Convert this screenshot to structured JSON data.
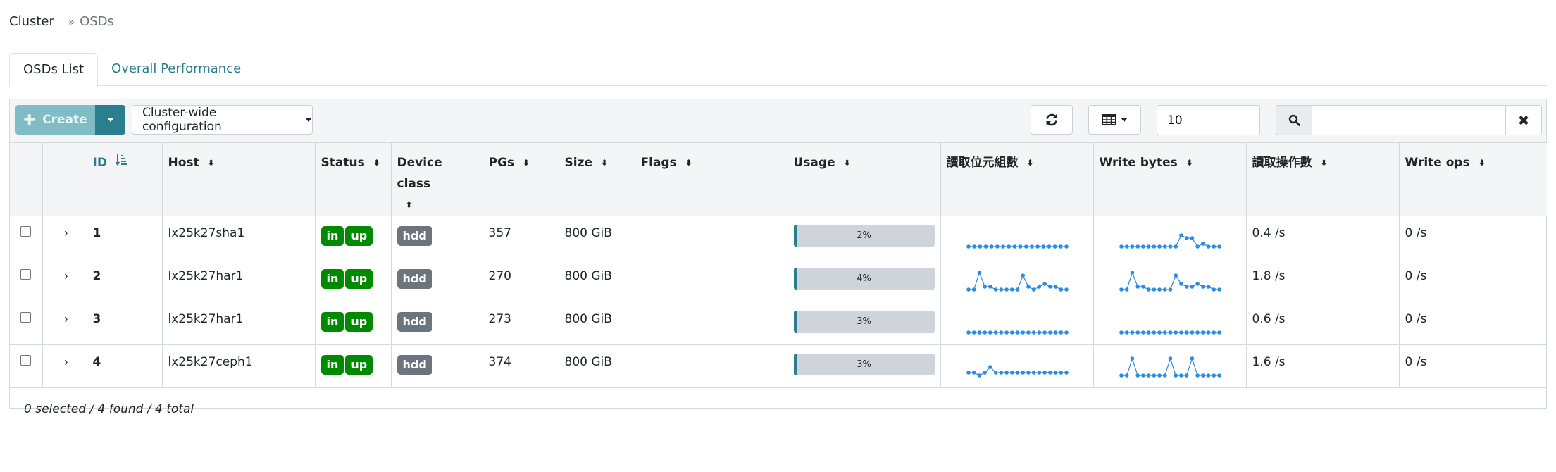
{
  "breadcrumb": {
    "root": "Cluster",
    "sep": "»",
    "current": "OSDs"
  },
  "tabs": [
    {
      "label": "OSDs List",
      "active": true
    },
    {
      "label": "Overall Performance",
      "active": false
    }
  ],
  "toolbar": {
    "create_label": "Create",
    "config_label": "Cluster-wide configuration",
    "page_size": "10",
    "search_value": "",
    "clear_label": "✖"
  },
  "columns": [
    {
      "label": ""
    },
    {
      "label": ""
    },
    {
      "label": "ID",
      "sort": "asc"
    },
    {
      "label": "Host"
    },
    {
      "label": "Status"
    },
    {
      "label": "Device class"
    },
    {
      "label": "PGs"
    },
    {
      "label": "Size"
    },
    {
      "label": "Flags"
    },
    {
      "label": "Usage"
    },
    {
      "label": "讀取位元組數"
    },
    {
      "label": "Write bytes"
    },
    {
      "label": "讀取操作數"
    },
    {
      "label": "Write ops"
    }
  ],
  "rows": [
    {
      "id": "1",
      "host": "lx25k27sha1",
      "status": [
        "in",
        "up"
      ],
      "device_class": "hdd",
      "pgs": "357",
      "size": "800 GiB",
      "flags": "",
      "usage": 2,
      "usage_label": "2%",
      "read_ops": "0.4 /s",
      "write_ops": "0 /s",
      "read_bytes_spark": [
        0,
        0,
        0,
        0,
        0,
        0,
        0,
        0,
        0,
        0,
        0,
        0,
        0,
        0,
        0,
        0,
        0,
        0
      ],
      "write_bytes_spark": [
        0,
        0,
        0,
        0,
        0,
        0,
        0,
        0,
        0,
        0,
        0,
        4,
        3,
        3,
        0,
        1,
        0,
        0,
        0
      ]
    },
    {
      "id": "2",
      "host": "lx25k27har1",
      "status": [
        "in",
        "up"
      ],
      "device_class": "hdd",
      "pgs": "270",
      "size": "800 GiB",
      "flags": "",
      "usage": 4,
      "usage_label": "4%",
      "read_ops": "1.8 /s",
      "write_ops": "0 /s",
      "read_bytes_spark": [
        0,
        0,
        6,
        1,
        1,
        0,
        0,
        0,
        0,
        0,
        5,
        1,
        0,
        1,
        2,
        1,
        1,
        0,
        0
      ],
      "write_bytes_spark": [
        0,
        0,
        6,
        1,
        1,
        0,
        0,
        0,
        0,
        0,
        5,
        2,
        1,
        1,
        2,
        1,
        1,
        0,
        0
      ]
    },
    {
      "id": "3",
      "host": "lx25k27har1",
      "status": [
        "in",
        "up"
      ],
      "device_class": "hdd",
      "pgs": "273",
      "size": "800 GiB",
      "flags": "",
      "usage": 3,
      "usage_label": "3%",
      "read_ops": "0.6 /s",
      "write_ops": "0 /s",
      "read_bytes_spark": [
        0,
        0,
        0,
        0,
        0,
        0,
        0,
        0,
        0,
        0,
        0,
        0,
        0,
        0,
        0,
        0,
        0,
        0,
        0
      ],
      "write_bytes_spark": [
        0,
        0,
        0,
        0,
        0,
        0,
        0,
        0,
        0,
        0,
        0,
        0,
        0,
        0,
        0,
        0,
        0,
        0,
        0
      ]
    },
    {
      "id": "4",
      "host": "lx25k27ceph1",
      "status": [
        "in",
        "up"
      ],
      "device_class": "hdd",
      "pgs": "374",
      "size": "800 GiB",
      "flags": "",
      "usage": 3,
      "usage_label": "3%",
      "read_ops": "1.6 /s",
      "write_ops": "0 /s",
      "read_bytes_spark": [
        1,
        1,
        0,
        1,
        3,
        1,
        1,
        1,
        1,
        1,
        1,
        1,
        1,
        1,
        1,
        1,
        1,
        1,
        1
      ],
      "write_bytes_spark": [
        0,
        0,
        6,
        0,
        0,
        0,
        0,
        0,
        0,
        6,
        0,
        0,
        0,
        6,
        0,
        0,
        0,
        0,
        0
      ]
    }
  ],
  "footer": {
    "summary": "0 selected / 4 found / 4 total"
  },
  "colors": {
    "accent": "#2a7e8d",
    "badge_green": "#008a00",
    "badge_grey": "#6c757d",
    "spark": "#2b8ce0"
  }
}
